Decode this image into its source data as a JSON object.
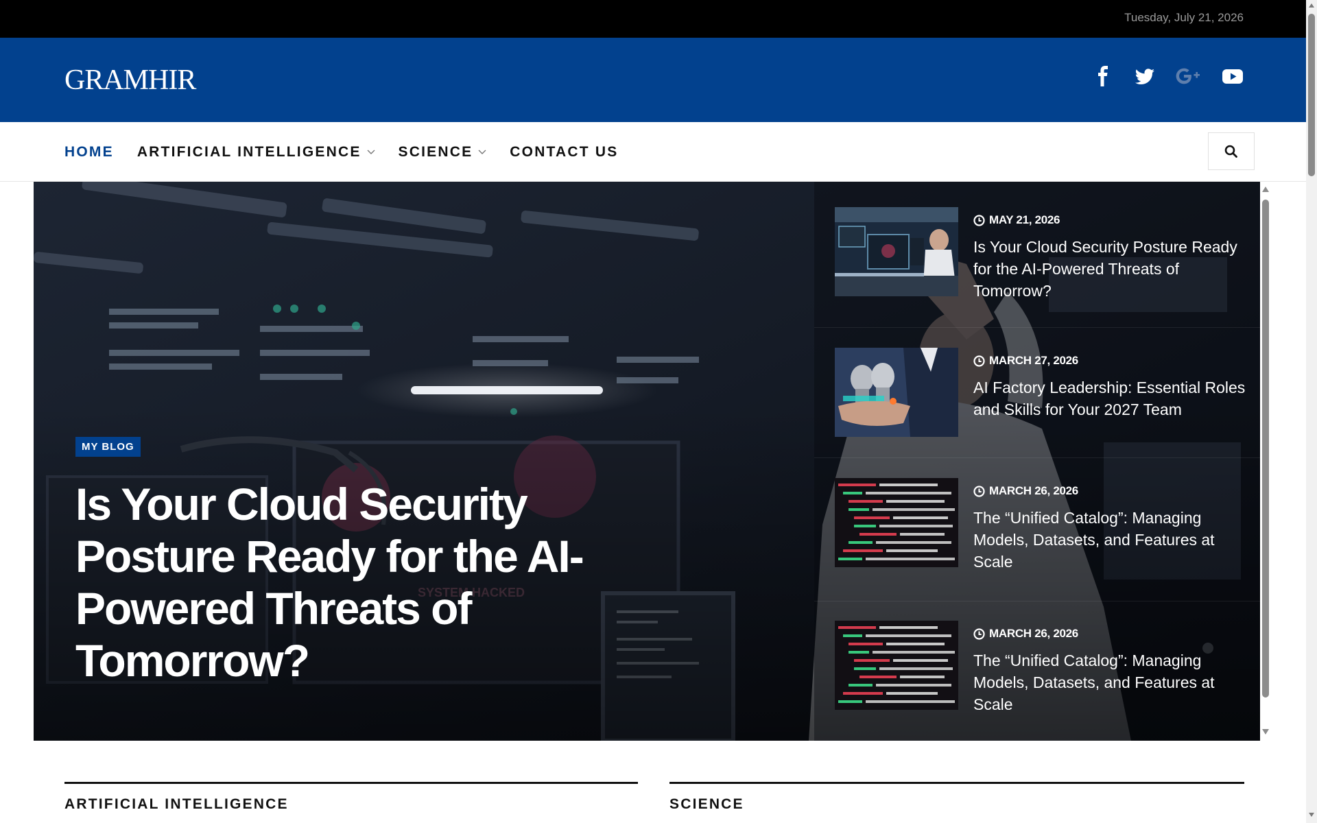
{
  "topbar": {
    "date": "Tuesday, July 21, 2026"
  },
  "header": {
    "logo": "GRAMHIR",
    "social": [
      {
        "icon": "facebook-icon",
        "color": "#ffffff"
      },
      {
        "icon": "twitter-icon",
        "color": "#ffffff"
      },
      {
        "icon": "google-plus-icon",
        "color": "#5f7fad"
      },
      {
        "icon": "youtube-icon",
        "color": "#ffffff"
      }
    ]
  },
  "nav": {
    "items": [
      {
        "label": "HOME",
        "active": true
      },
      {
        "label": "ARTIFICIAL INTELLIGENCE",
        "dropdown": true
      },
      {
        "label": "SCIENCE",
        "dropdown": true
      },
      {
        "label": "CONTACT US"
      }
    ],
    "search_icon": "search-icon"
  },
  "hero": {
    "badge": "MY BLOG",
    "title": "Is Your Cloud Security Posture Ready for the AI-Powered Threats of Tomorrow?",
    "side_posts": [
      {
        "date": "MAY 21, 2026",
        "title": "Is Your Cloud Security Posture Ready for the AI-Powered Threats of Tomorrow?",
        "thumb": "server-room"
      },
      {
        "date": "MARCH 27, 2026",
        "title": "AI Factory Leadership: Essential Roles and Skills for Your 2027 Team",
        "thumb": "ai-robots"
      },
      {
        "date": "MARCH 26, 2026",
        "title": "The “Unified Catalog”: Managing Models, Datasets, and Features at Scale",
        "thumb": "code"
      },
      {
        "date": "MARCH 26, 2026",
        "title": "The “Unified Catalog”: Managing Models, Datasets, and Features at Scale",
        "thumb": "code"
      }
    ]
  },
  "sections": {
    "ai": "ARTIFICIAL INTELLIGENCE",
    "science": "SCIENCE"
  },
  "colors": {
    "brand": "#02418e",
    "topbar": "#000000"
  }
}
